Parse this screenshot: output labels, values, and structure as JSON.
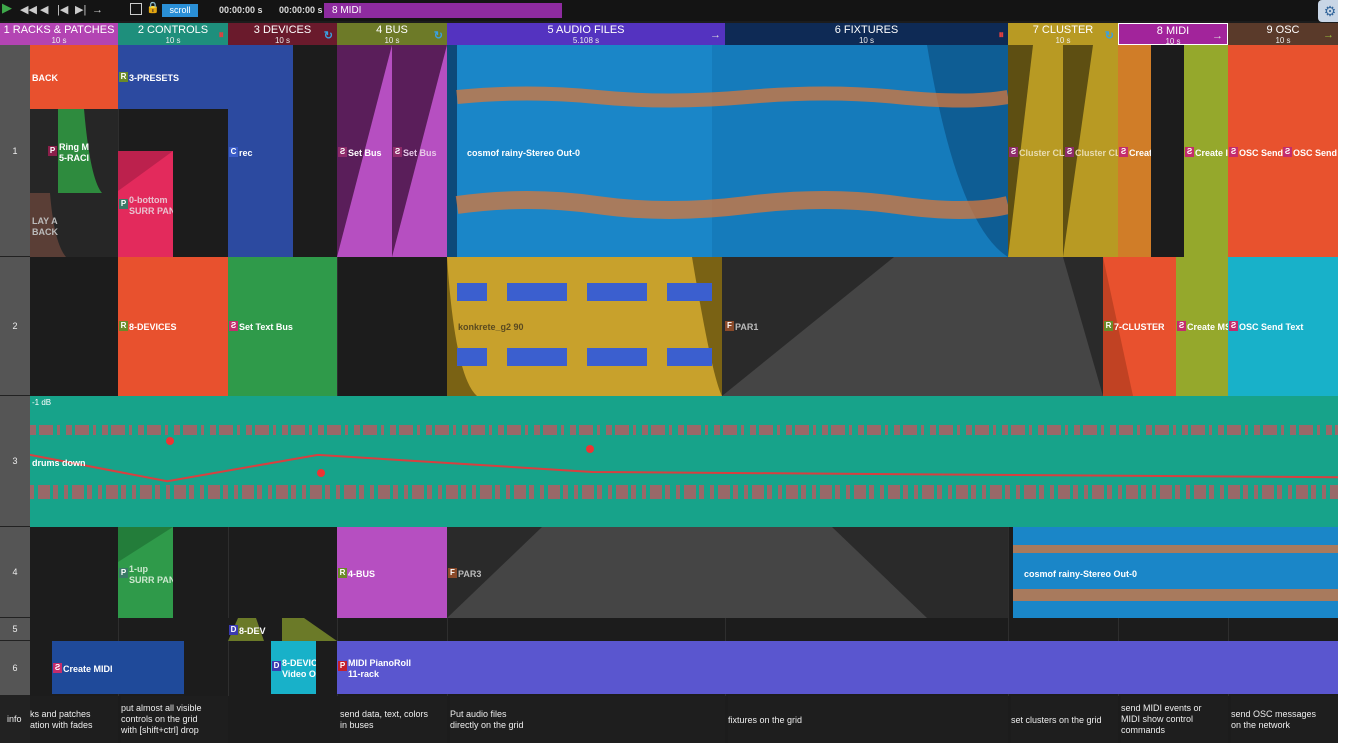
{
  "toolbar": {
    "buttons": [
      "play-icon",
      "rewind-icon",
      "step-back-icon",
      "skip-start-icon",
      "skip-end-icon",
      "forward-icon",
      "fullscreen-icon",
      "lock-icon"
    ],
    "scroll_label": "scroll",
    "time1": "00:00:00 s",
    "time2": "00:00:00 s",
    "midi_tab": "8 MIDI"
  },
  "columns": [
    {
      "name": "1 RACKS & PATCHES",
      "duration": "10 s",
      "color": "#b344b3"
    },
    {
      "name": "2 CONTROLS",
      "duration": "10 s",
      "color": "#1e8f7c"
    },
    {
      "name": "3 DEVICES",
      "duration": "10 s",
      "color": "#6a1a2c"
    },
    {
      "name": "4 BUS",
      "duration": "10 s",
      "color": "#6d7a28"
    },
    {
      "name": "5 AUDIO FILES",
      "duration": "5.108 s",
      "color": "#5433c0"
    },
    {
      "name": "6 FIXTURES",
      "duration": "10 s",
      "color": "#0e2a55"
    },
    {
      "name": "7 CLUSTER",
      "duration": "10 s",
      "color": "#b89a23"
    },
    {
      "name": "8 MIDI",
      "duration": "10 s",
      "color": "#a2249b"
    },
    {
      "name": "9 OSC",
      "duration": "10 s",
      "color": "#5a3a2a"
    }
  ],
  "header_icons": {
    "c1": "↻",
    "c2": "⏸",
    "c3": "↻",
    "c4": "↻",
    "c5": "→",
    "c6": "⏸",
    "c7": "↻",
    "c8": "→",
    "c9": "→"
  },
  "rows": [
    "1",
    "2",
    "3",
    "4",
    "5",
    "6"
  ],
  "cells": {
    "r1_back": "BACK",
    "r1_ring_a": "Ring M",
    "r1_ring_b": "5-RACI",
    "r1_play_a": "LAY A",
    "r1_play_b": "BACK",
    "r1_presets": "3-PRESETS",
    "r1_bottom_a": "0-bottom",
    "r1_bottom_b": "SURR PAN",
    "r1_rec": "rec",
    "r1_setbus1": "Set Bus",
    "r1_setbus2": "Set Bus",
    "r1_audio": "cosmof rainy-Stereo Out-0",
    "r1_cluster1": "Cluster CL",
    "r1_cluster2": "Cluster CL",
    "r1_creat": "Creat",
    "r1_create": "Create I",
    "r1_osc1": "OSC Send",
    "r1_osc2": "OSC Send",
    "r2_devices": "8-DEVICES",
    "r2_settext": "Set Text Bus",
    "r2_audio": "konkrete_g2 90",
    "r2_par1": "PAR1",
    "r2_cluster": "7-CLUSTER",
    "r2_createms": "Create MS",
    "r2_osctext": "OSC Send Text",
    "r3_db": "-1 dB",
    "r3_label": "drums down",
    "r4_up_a": "1-up",
    "r4_up_b": "SURR PAN",
    "r4_bus": "4-BUS",
    "r4_par3": "PAR3",
    "r4_audio": "cosmof rainy-Stereo Out-0",
    "r5_dev": "8-DEV",
    "r6_createmidi": "Create MIDI",
    "r6_dev_a": "8-DEVIC",
    "r6_dev_b": "Video O",
    "r6_piano_a": "MIDI PianoRoll",
    "r6_piano_b": "11-rack"
  },
  "badges": {
    "R": "R",
    "P": "P",
    "S": "Ƨ",
    "C": "C",
    "F": "F",
    "D": "D"
  },
  "info": {
    "label": "info",
    "c1": [
      "ks and patches",
      "ation with fades"
    ],
    "c2": [
      "put almost all visible",
      "controls on the grid",
      "with [shift+ctrl] drop"
    ],
    "c4": [
      "send data, text, colors",
      "in buses"
    ],
    "c5": [
      "Put audio files",
      "directly on the grid"
    ],
    "c6": [
      "fixtures on the grid"
    ],
    "c7": [
      "set clusters on the grid"
    ],
    "c8": [
      "send MIDI events or",
      "MIDI show control",
      "commands"
    ],
    "c9": [
      "send OSC messages",
      "on the network"
    ]
  },
  "automation_points": [
    [
      0.0,
      0.55
    ],
    [
      0.105,
      0.35
    ],
    [
      0.22,
      0.55
    ],
    [
      0.43,
      0.42
    ],
    [
      1.0,
      0.38
    ]
  ]
}
